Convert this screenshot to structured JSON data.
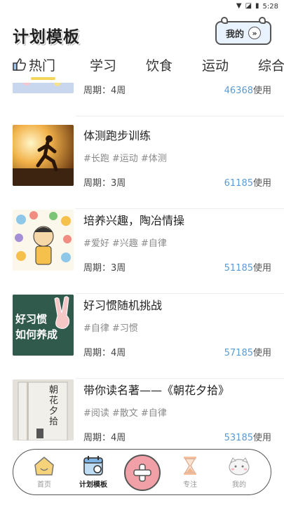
{
  "status_bar": {
    "time": "5:28",
    "wifi_icon": "wifi-icon",
    "signal_icon": "signal-off-icon",
    "battery_icon": "battery-icon"
  },
  "header": {
    "title": "计划模板",
    "mine_label": "我的"
  },
  "tabs": [
    {
      "label": "热门",
      "active": true
    },
    {
      "label": "学习",
      "active": false
    },
    {
      "label": "饮食",
      "active": false
    },
    {
      "label": "运动",
      "active": false
    },
    {
      "label": "综合",
      "active": false
    }
  ],
  "plans": [
    {
      "title": "",
      "tags": [],
      "period": "周期：4周",
      "uses_count": "46368",
      "uses_suffix": "使用"
    },
    {
      "title": "体测跑步训练",
      "tags": [
        "#长跑",
        "#运动",
        "#体测"
      ],
      "period": "周期：3周",
      "uses_count": "61185",
      "uses_suffix": "使用"
    },
    {
      "title": "培养兴趣，陶冶情操",
      "tags": [
        "#爱好",
        "#兴趣",
        "#自律"
      ],
      "period": "周期：3周",
      "uses_count": "51185",
      "uses_suffix": "使用"
    },
    {
      "title": "好习惯随机挑战",
      "tags": [
        "#自律",
        "#习惯"
      ],
      "period": "周期：4周",
      "uses_count": "57185",
      "uses_suffix": "使用",
      "thumb_text": [
        "好习惯",
        "如何养成"
      ]
    },
    {
      "title": "带你读名著——《朝花夕拾》",
      "tags": [
        "#阅读",
        "#散文",
        "#自律"
      ],
      "period": "周期：4周",
      "uses_count": "53185",
      "uses_suffix": "使用",
      "thumb_text": [
        "朝花夕拾"
      ]
    }
  ],
  "bottom_nav": [
    {
      "label": "首页",
      "icon": "home-icon",
      "active": false
    },
    {
      "label": "计划模板",
      "icon": "calendar-icon",
      "active": true
    },
    {
      "label": "",
      "icon": "plus-icon",
      "active": false
    },
    {
      "label": "专注",
      "icon": "hourglass-icon",
      "active": false
    },
    {
      "label": "我的",
      "icon": "cat-face-icon",
      "active": false
    }
  ],
  "colors": {
    "accent_blue": "#5b9bd5",
    "tab_underline": "#f4d45a",
    "add_button": "#f2a0a7"
  }
}
